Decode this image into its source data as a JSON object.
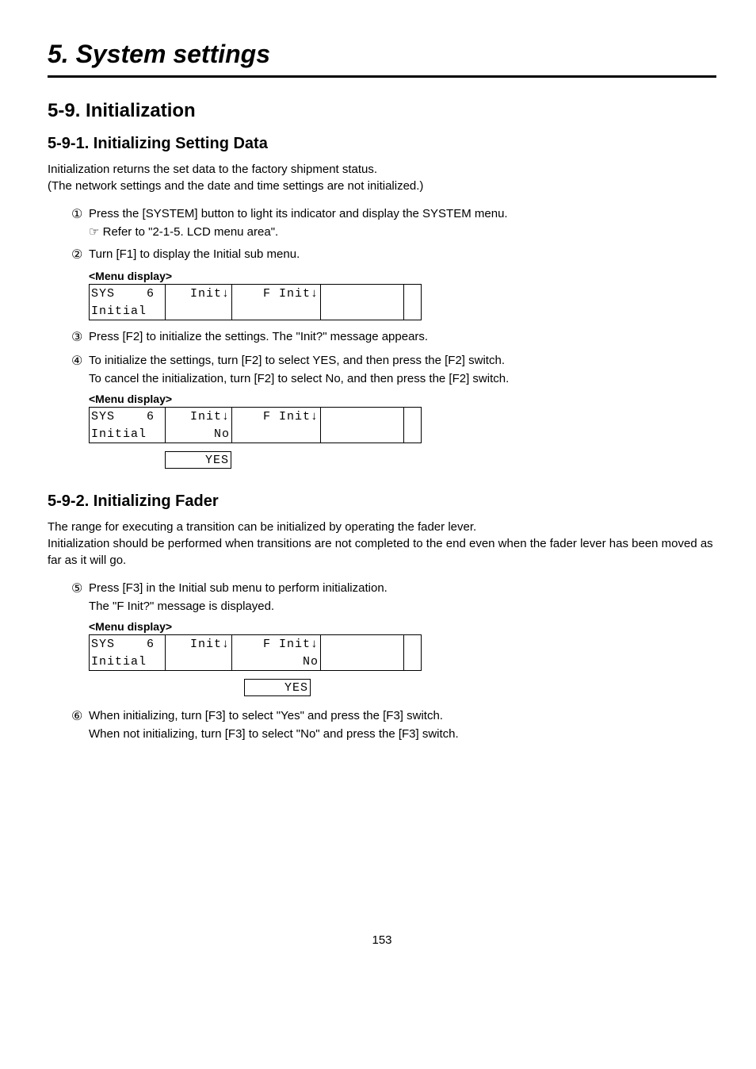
{
  "chapter": "5. System settings",
  "section": "5-9. Initialization",
  "sub591": {
    "title": "5-9-1. Initializing Setting Data",
    "intro1": "Initialization returns the set data to the factory shipment status.",
    "intro2": "(The network settings and the date and time settings are not initialized.)",
    "step1": "Press the [SYSTEM] button to light its indicator and display the SYSTEM menu.",
    "refer": "☞ Refer to \"2-1-5. LCD menu area\".",
    "step2": "Turn [F1] to display the Initial sub menu.",
    "step3": "Press [F2] to initialize the settings. The \"Init?\" message appears.",
    "step4a": "To initialize the settings, turn [F2] to select YES, and then press the [F2] switch.",
    "step4b": "To cancel the initialization, turn [F2] to select No, and then press the [F2] switch."
  },
  "sub592": {
    "title": "5-9-2. Initializing Fader",
    "intro1": "The range for executing a transition can be initialized by operating the fader lever.",
    "intro2": "Initialization should be performed when transitions are not completed to the end even when the fader lever has been moved as far as it will go.",
    "step5a": "Press [F3] in the Initial sub menu to perform initialization.",
    "step5b": "The \"F Init?\" message is displayed.",
    "step6a": "When initializing, turn [F3] to select \"Yes\" and press the [F3] switch.",
    "step6b": "When not initializing, turn [F3] to select \"No\" and press the [F3] switch."
  },
  "labels": {
    "menuDisplay": "<Menu display>"
  },
  "display1": {
    "r1": {
      "c1": "SYS    6",
      "c2": "Init↓",
      "c3": "F Init↓",
      "c4": "",
      "c5": ""
    },
    "r2": {
      "c1": "Initial ",
      "c2": "",
      "c3": "",
      "c4": "",
      "c5": ""
    }
  },
  "display2": {
    "r1": {
      "c1": "SYS    6",
      "c2": "Init↓",
      "c3": "F Init↓",
      "c4": "",
      "c5": ""
    },
    "r2": {
      "c1": "Initial ",
      "c2": "No",
      "c3": "",
      "c4": "",
      "c5": ""
    },
    "yes": "YES"
  },
  "display3": {
    "r1": {
      "c1": "SYS    6",
      "c2": "Init↓",
      "c3": "F Init↓",
      "c4": "",
      "c5": ""
    },
    "r2": {
      "c1": "Initial ",
      "c2": "",
      "c3": "No",
      "c4": "",
      "c5": ""
    },
    "yes": "YES"
  },
  "nums": {
    "n1": "①",
    "n2": "②",
    "n3": "③",
    "n4": "④",
    "n5": "⑤",
    "n6": "⑥"
  },
  "page": "153"
}
